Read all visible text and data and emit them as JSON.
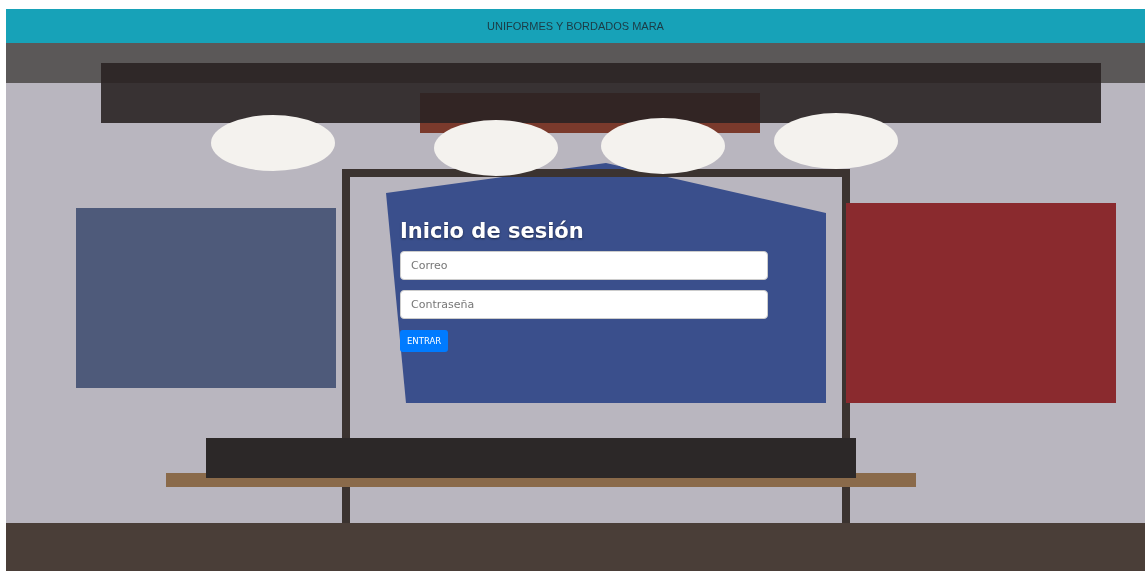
{
  "header": {
    "title": "UNIFORMES Y BORDADOS MARA"
  },
  "login": {
    "title": "Inicio de sesión",
    "fields": [
      {
        "placeholder": "Correo"
      },
      {
        "placeholder": "Contraseña"
      }
    ],
    "button": "ENTRAR"
  }
}
